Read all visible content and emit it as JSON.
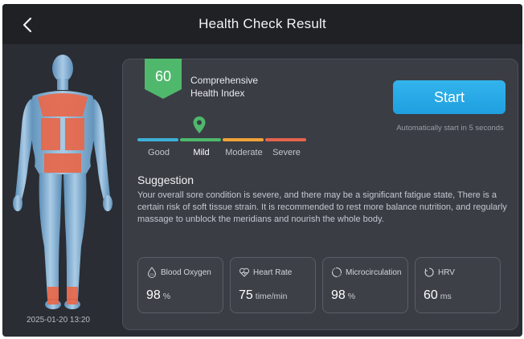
{
  "header": {
    "title": "Health Check Result",
    "back_icon": "chevron-left-icon"
  },
  "status": {
    "date_time": "2025-01-20  13:20"
  },
  "index": {
    "score": "60",
    "label": "Comprehensive Health Index",
    "badge_color": "#4fb86c"
  },
  "start": {
    "button_label": "Start",
    "auto_text": "Automatically start in 5 seconds"
  },
  "scale": {
    "levels": [
      {
        "label": "Good",
        "color": "#3fb0d9"
      },
      {
        "label": "Mild",
        "color": "#4fb86c"
      },
      {
        "label": "Moderate",
        "color": "#f0a23a"
      },
      {
        "label": "Severe",
        "color": "#e5634d"
      }
    ],
    "current": "Mild",
    "marker_icon": "location-pin-icon"
  },
  "suggestion": {
    "title": "Suggestion",
    "text": "Your overall sore condition is severe, and there may be a significant fatigue state, There is a certain risk of soft tissue strain. It is recommended to rest more balance nutrition, and regularly massage to unblock the meridians and nourish the whole body."
  },
  "metrics": [
    {
      "label": "Blood Oxygen",
      "value": "98",
      "unit": "%",
      "icon": "blood-oxygen-icon"
    },
    {
      "label": "Heart Rate",
      "value": "75",
      "unit": "time/min",
      "icon": "heart-rate-icon"
    },
    {
      "label": "Microcirculation",
      "value": "98",
      "unit": "%",
      "icon": "microcirculation-icon"
    },
    {
      "label": "HRV",
      "value": "60",
      "unit": "ms",
      "icon": "hrv-icon"
    }
  ],
  "body_map": {
    "highlight_color": "#e8684a",
    "highlighted_regions": [
      "upper back",
      "shoulders",
      "lower back",
      "calves"
    ]
  }
}
